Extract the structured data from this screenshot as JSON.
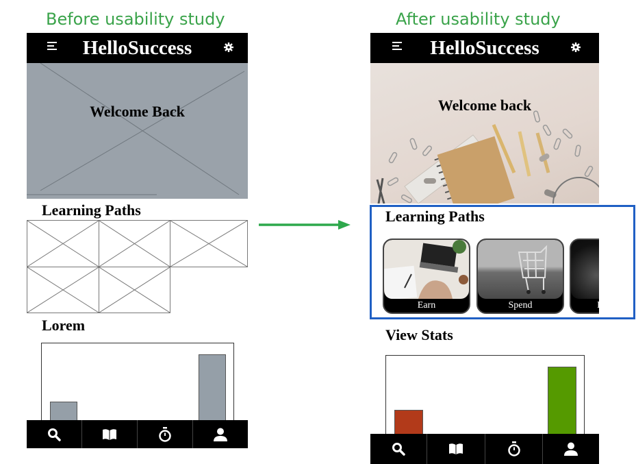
{
  "captions": {
    "before": "Before usability study",
    "after": "After usability study"
  },
  "before": {
    "app_title": "HelloSuccess",
    "hero_text": "Welcome Back",
    "section1": "Learning Paths",
    "section2": "Lorem",
    "chart_data": {
      "type": "bar",
      "categories": [
        "",
        ""
      ],
      "values": [
        38,
        98
      ],
      "colors": [
        "#959fa8",
        "#959fa8"
      ]
    }
  },
  "after": {
    "app_title": "HelloSuccess",
    "hero_text": "Welcome back",
    "section1": "Learning Paths",
    "cards": [
      {
        "label": "Earn"
      },
      {
        "label": "Spend"
      },
      {
        "label": "I"
      }
    ],
    "section2": "View Stats",
    "chart_data": {
      "type": "bar",
      "categories": [
        "",
        ""
      ],
      "values": [
        38,
        100
      ],
      "colors": [
        "#b23a1a",
        "#559a00"
      ]
    }
  },
  "nav": [
    "search-icon",
    "book-icon",
    "stopwatch-icon",
    "user-icon"
  ],
  "colors": {
    "caption": "#3aa34a",
    "placeholder_gray": "#9aa2aa",
    "highlight": "#1f5fc4",
    "arrow": "#2ea84c"
  }
}
